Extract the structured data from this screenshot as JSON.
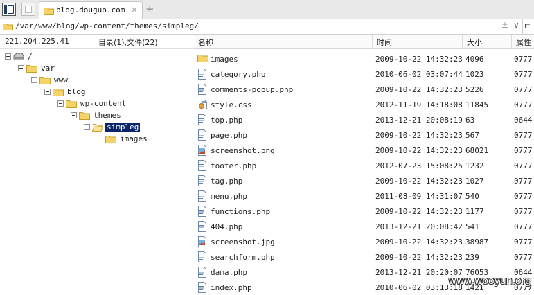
{
  "tab": {
    "title": "blog.douguo.com",
    "close": "×",
    "new": "+"
  },
  "address": {
    "path": "/var/www/blog/wp-content/themes/simpleg/",
    "ctl1": "±",
    "ctl2": "∨",
    "tail": "⊏"
  },
  "left_header": {
    "ip": "221.204.225.41",
    "counts": "目录(1),文件(22)"
  },
  "tree": [
    {
      "label": "/",
      "icon": "drive-icon"
    },
    {
      "label": "var",
      "icon": "folder-icon"
    },
    {
      "label": "www",
      "icon": "folder-icon"
    },
    {
      "label": "blog",
      "icon": "folder-icon"
    },
    {
      "label": "wp-content",
      "icon": "folder-icon"
    },
    {
      "label": "themes",
      "icon": "folder-icon"
    },
    {
      "label": "simpleg",
      "icon": "folder-open-icon",
      "selected": true
    },
    {
      "label": "images",
      "icon": "folder-icon"
    }
  ],
  "columns": {
    "name": "名称",
    "time": "时间",
    "size": "大小",
    "perm": "属性"
  },
  "files": [
    {
      "name": "images",
      "time": "2009-10-22 14:32:23",
      "size": "4096",
      "perm": "0777",
      "type": "folder"
    },
    {
      "name": "category.php",
      "time": "2010-06-02 03:07:44",
      "size": "1023",
      "perm": "0777",
      "type": "php"
    },
    {
      "name": "comments-popup.php",
      "time": "2009-10-22 14:32:23",
      "size": "5226",
      "perm": "0777",
      "type": "php"
    },
    {
      "name": "style.css",
      "time": "2012-11-19 14:18:08",
      "size": "11845",
      "perm": "0777",
      "type": "css"
    },
    {
      "name": "top.php",
      "time": "2013-12-21 20:08:19",
      "size": "63",
      "perm": "0644",
      "type": "php"
    },
    {
      "name": "page.php",
      "time": "2009-10-22 14:32:23",
      "size": "567",
      "perm": "0777",
      "type": "php"
    },
    {
      "name": "screenshot.png",
      "time": "2009-10-22 14:32:23",
      "size": "68021",
      "perm": "0777",
      "type": "image"
    },
    {
      "name": "footer.php",
      "time": "2012-07-23 15:08:25",
      "size": "1232",
      "perm": "0777",
      "type": "php"
    },
    {
      "name": "tag.php",
      "time": "2009-10-22 14:32:23",
      "size": "1027",
      "perm": "0777",
      "type": "php"
    },
    {
      "name": "menu.php",
      "time": "2011-08-09 14:31:07",
      "size": "540",
      "perm": "0777",
      "type": "php"
    },
    {
      "name": "functions.php",
      "time": "2009-10-22 14:32:23",
      "size": "1177",
      "perm": "0777",
      "type": "php"
    },
    {
      "name": "404.php",
      "time": "2013-12-21 20:08:42",
      "size": "541",
      "perm": "0777",
      "type": "php"
    },
    {
      "name": "screenshot.jpg",
      "time": "2009-10-22 14:32:23",
      "size": "38987",
      "perm": "0777",
      "type": "image"
    },
    {
      "name": "searchform.php",
      "time": "2009-10-22 14:32:23",
      "size": "239",
      "perm": "0777",
      "type": "php"
    },
    {
      "name": "dama.php",
      "time": "2013-12-21 20:20:07",
      "size": "76053",
      "perm": "0644",
      "type": "php"
    },
    {
      "name": "index.php",
      "time": "2010-06-02 03:13:18",
      "size": "1421",
      "perm": "0777",
      "type": "php"
    }
  ],
  "watermark": "www.wooyun.org",
  "colors": {
    "selection": "#0a246a",
    "folder": "#f4d469",
    "folder_border": "#c8a029",
    "accent": "#1f3b66"
  }
}
